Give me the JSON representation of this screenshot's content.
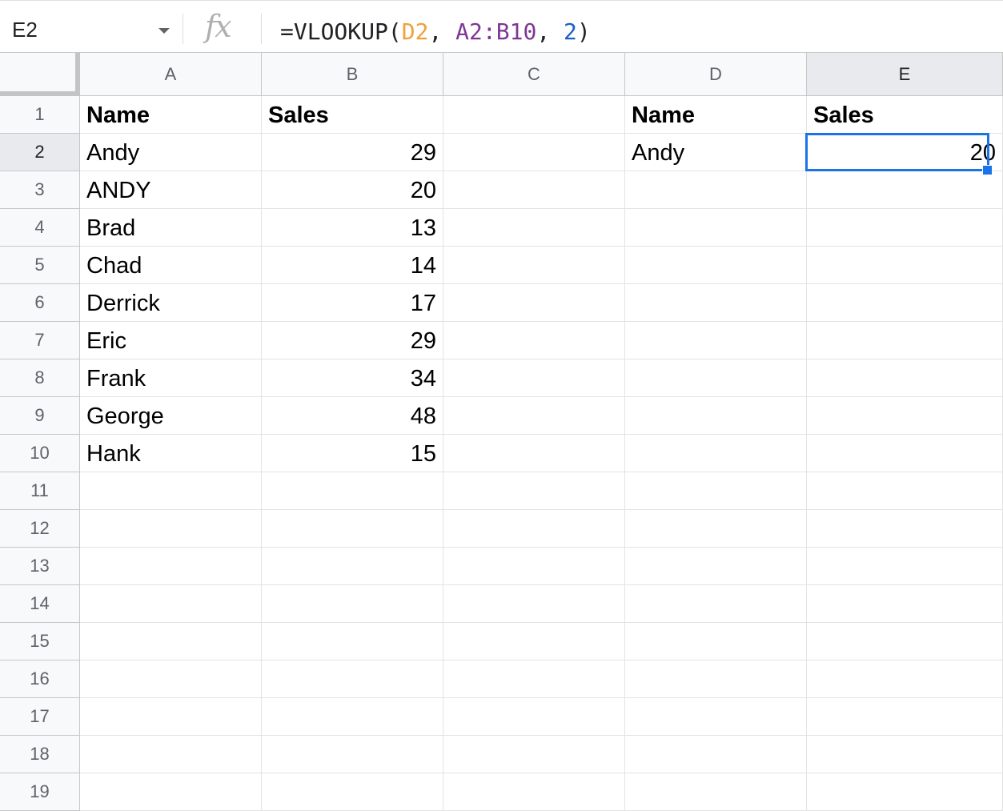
{
  "name_box": {
    "cell_ref": "E2"
  },
  "formula_bar": {
    "fx_icon": "fx",
    "formula_tokens": [
      {
        "text": "=VLOOKUP(",
        "kind": "plain"
      },
      {
        "text": "D2",
        "kind": "d2"
      },
      {
        "text": ", ",
        "kind": "plain"
      },
      {
        "text": "A2:B10",
        "kind": "range"
      },
      {
        "text": ", ",
        "kind": "plain"
      },
      {
        "text": "2",
        "kind": "num"
      },
      {
        "text": ")",
        "kind": "plain"
      }
    ]
  },
  "columns": [
    "A",
    "B",
    "C",
    "D",
    "E"
  ],
  "selected": {
    "column": "E",
    "row": "2"
  },
  "rows": [
    {
      "num": "1",
      "cells": [
        "Name",
        "Sales",
        "",
        "Name",
        "Sales"
      ]
    },
    {
      "num": "2",
      "cells": [
        "Andy",
        "29",
        "",
        "Andy",
        "20"
      ]
    },
    {
      "num": "3",
      "cells": [
        "ANDY",
        "20",
        "",
        "",
        ""
      ]
    },
    {
      "num": "4",
      "cells": [
        "Brad",
        "13",
        "",
        "",
        ""
      ]
    },
    {
      "num": "5",
      "cells": [
        "Chad",
        "14",
        "",
        "",
        ""
      ]
    },
    {
      "num": "6",
      "cells": [
        "Derrick",
        "17",
        "",
        "",
        ""
      ]
    },
    {
      "num": "7",
      "cells": [
        "Eric",
        "29",
        "",
        "",
        ""
      ]
    },
    {
      "num": "8",
      "cells": [
        "Frank",
        "34",
        "",
        "",
        ""
      ]
    },
    {
      "num": "9",
      "cells": [
        "George",
        "48",
        "",
        "",
        ""
      ]
    },
    {
      "num": "10",
      "cells": [
        "Hank",
        "15",
        "",
        "",
        ""
      ]
    },
    {
      "num": "11",
      "cells": [
        "",
        "",
        "",
        "",
        ""
      ]
    },
    {
      "num": "12",
      "cells": [
        "",
        "",
        "",
        "",
        ""
      ]
    },
    {
      "num": "13",
      "cells": [
        "",
        "",
        "",
        "",
        ""
      ]
    },
    {
      "num": "14",
      "cells": [
        "",
        "",
        "",
        "",
        ""
      ]
    },
    {
      "num": "15",
      "cells": [
        "",
        "",
        "",
        "",
        ""
      ]
    },
    {
      "num": "16",
      "cells": [
        "",
        "",
        "",
        "",
        ""
      ]
    },
    {
      "num": "17",
      "cells": [
        "",
        "",
        "",
        "",
        ""
      ]
    },
    {
      "num": "18",
      "cells": [
        "",
        "",
        "",
        "",
        ""
      ]
    },
    {
      "num": "19",
      "cells": [
        "",
        "",
        "",
        "",
        ""
      ]
    }
  ],
  "colors": {
    "selection": "#1a73e8",
    "header_bg": "#f8f9fa",
    "gridline": "#e2e3e3"
  }
}
